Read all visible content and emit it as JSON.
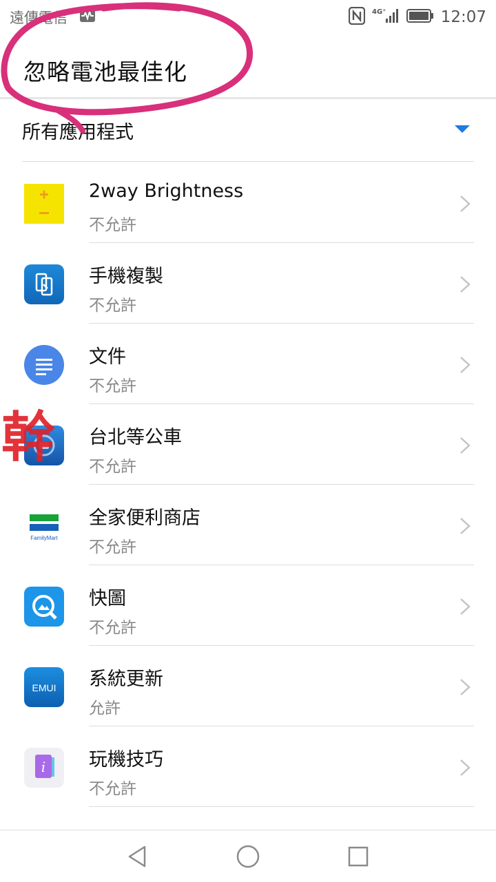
{
  "status_bar": {
    "carrier": "遠傳電信",
    "network": "4G⁺",
    "time": "12:07"
  },
  "page": {
    "title": "忽略電池最佳化"
  },
  "filter": {
    "label": "所有應用程式"
  },
  "apps": [
    {
      "name": "2way Brightness",
      "status": "不允許",
      "icon": "brightness-icon"
    },
    {
      "name": "手機複製",
      "status": "不允許",
      "icon": "phone-clone-icon"
    },
    {
      "name": "文件",
      "status": "不允許",
      "icon": "docs-icon"
    },
    {
      "name": "台北等公車",
      "status": "不允許",
      "icon": "bus-icon"
    },
    {
      "name": "全家便利商店",
      "status": "不允許",
      "icon": "familymart-icon"
    },
    {
      "name": "快圖",
      "status": "不允許",
      "icon": "quickpic-icon"
    },
    {
      "name": "系統更新",
      "status": "允許",
      "icon": "emui-icon"
    },
    {
      "name": "玩機技巧",
      "status": "不允許",
      "icon": "tips-icon"
    }
  ],
  "icon_labels": {
    "familymart": "FamilyMart",
    "emui": "EMUI",
    "tips": "i"
  },
  "overlay": {
    "stamp_char": "幹",
    "highlight_color": "#d8307a"
  },
  "colors": {
    "accent": "#1f7ae0"
  }
}
